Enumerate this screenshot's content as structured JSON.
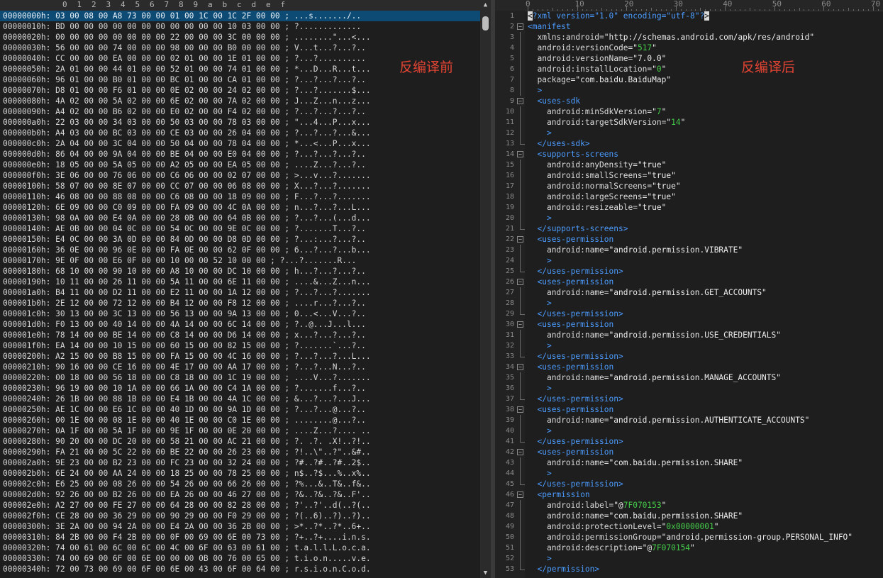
{
  "labels": {
    "before": "反编译前",
    "after": "反编译后"
  },
  "hex": {
    "ruler": [
      "0",
      "1",
      "2",
      "3",
      "4",
      "5",
      "6",
      "7",
      "8",
      "9",
      "a",
      "b",
      "c",
      "d",
      "e",
      "f"
    ],
    "rows": [
      "00000000h: 03 00 08 00 A8 73 00 00 01 00 1C 00 1C 2F 00 00 ; ...s......./..",
      "00000010h: BD 00 00 00 00 00 00 00 00 00 00 00 10 03 00 00 ; ?.............",
      "00000020h: 00 00 00 00 00 00 00 00 22 00 00 00 3C 00 00 00 ; ........\"...<...",
      "00000030h: 56 00 00 00 74 00 00 00 98 00 00 00 B0 00 00 00 ; V...t...?...?..",
      "00000040h: CC 00 00 00 EA 00 00 00 02 01 00 00 1E 01 00 00 ; ?...?..........",
      "00000050h: 2A 01 00 00 44 01 00 00 52 01 00 00 74 01 00 00 ; *...D...R...t...",
      "00000060h: 96 01 00 00 B0 01 00 00 BC 01 00 00 CA 01 00 00 ; ?...?...?...?..",
      "00000070h: D8 01 00 00 F6 01 00 00 0E 02 00 00 24 02 00 00 ; ?...?.......$...",
      "00000080h: 4A 02 00 00 5A 02 00 00 6E 02 00 00 7A 02 00 00 ; J...Z...n...z...",
      "00000090h: A4 02 00 00 B6 02 00 00 E0 02 00 00 F4 02 00 00 ; ?...?...?...?..",
      "000000a0h: 22 03 00 00 34 03 00 00 50 03 00 00 78 03 00 00 ; \"...4...P...x...",
      "000000b0h: A4 03 00 00 BC 03 00 00 CE 03 00 00 26 04 00 00 ; ?...?...?...&...",
      "000000c0h: 2A 04 00 00 3C 04 00 00 50 04 00 00 78 04 00 00 ; *...<...P...x...",
      "000000d0h: 86 04 00 00 9A 04 00 00 BE 04 00 00 E0 04 00 00 ; ?...?...?...?..",
      "000000e0h: 18 05 00 00 5A 05 00 00 A2 05 00 00 EA 05 00 00 ; ....Z...?...?..",
      "000000f0h: 3E 06 00 00 76 06 00 00 C6 06 00 00 02 07 00 00 ; >...v...?.......",
      "00000100h: 58 07 00 00 8E 07 00 00 CC 07 00 00 06 08 00 00 ; X...?...?.......",
      "00000110h: 46 08 00 00 88 08 00 00 C6 08 00 00 18 09 00 00 ; F...?...?.......",
      "00000120h: 6E 09 00 00 C0 09 00 00 FA 09 00 00 4C 0A 00 00 ; n...?...?...L...",
      "00000130h: 98 0A 00 00 E4 0A 00 00 28 0B 00 00 64 0B 00 00 ; ?...?...(...d...",
      "00000140h: AE 0B 00 00 04 0C 00 00 54 0C 00 00 9E 0C 00 00 ; ?.......T...?..",
      "00000150h: E4 0C 00 00 3A 0D 00 00 84 0D 00 00 D8 0D 00 00 ; ?...:...?...?..",
      "00000160h: 36 0E 00 00 96 0E 00 00 FA 0E 00 00 62 0F 00 00 ; 6...?...?...b...",
      "00000170h: 9E 0F 00 00 E6 0F 00 00 10 00 00 52 10 00 00 ; ?...?.......R...",
      "00000180h: 68 10 00 00 90 10 00 00 A8 10 00 00 DC 10 00 00 ; h...?...?...?..",
      "00000190h: 10 11 00 00 26 11 00 00 5A 11 00 00 6E 11 00 00 ; ....&...Z...n...",
      "000001a0h: B4 11 00 00 D2 11 00 00 E2 11 00 00 1A 12 00 00 ; ?...?...?.......",
      "000001b0h: 2E 12 00 00 72 12 00 00 B4 12 00 00 F8 12 00 00 ; ....r...?...?..",
      "000001c0h: 30 13 00 00 3C 13 00 00 56 13 00 00 9A 13 00 00 ; 0...<...V...?..",
      "000001d0h: F0 13 00 00 40 14 00 00 4A 14 00 00 6C 14 00 00 ; ?..@...J...l...",
      "000001e0h: 78 14 00 00 BE 14 00 00 C8 14 00 00 D6 14 00 00 ; x...?...?...?..",
      "000001f0h: EA 14 00 00 10 15 00 00 60 15 00 00 82 15 00 00 ; ?.......`...?..",
      "00000200h: A2 15 00 00 B8 15 00 00 FA 15 00 00 4C 16 00 00 ; ?...?...?...L...",
      "00000210h: 90 16 00 00 CE 16 00 00 4E 17 00 00 AA 17 00 00 ; ?...?...N...?..",
      "00000220h: 00 18 00 00 56 18 00 00 C8 18 00 00 1C 19 00 00 ; ....V...?.......",
      "00000230h: 96 19 00 00 10 1A 00 00 66 1A 00 00 C4 1A 00 00 ; ?.......f...?..",
      "00000240h: 26 1B 00 00 88 1B 00 00 E4 1B 00 00 4A 1C 00 00 ; &...?...?...J...",
      "00000250h: AE 1C 00 00 E6 1C 00 00 40 1D 00 00 9A 1D 00 00 ; ?...?...@...?..",
      "00000260h: 00 1E 00 00 08 1E 00 00 40 1E 00 00 C0 1E 00 00 ; ........@...?..",
      "00000270h: 0A 1F 00 00 5A 1F 00 00 9E 1F 00 00 0E 20 00 00 ; ....Z...?.... ..",
      "00000280h: 90 20 00 00 DC 20 00 00 58 21 00 00 AC 21 00 00 ; ?. .?. .X!..?!..",
      "00000290h: FA 21 00 00 5C 22 00 00 BE 22 00 00 26 23 00 00 ; ?!..\\\"..?\"..&#..",
      "000002a0h: 9E 23 00 00 B2 23 00 00 FC 23 00 00 32 24 00 00 ; ?#..?#..?#..2$..",
      "000002b0h: 6E 24 00 00 AA 24 00 00 18 25 00 00 78 25 00 00 ; n$..?$...%..x%..",
      "000002c0h: E6 25 00 00 08 26 00 00 54 26 00 00 66 26 00 00 ; ?%...&..T&..f&..",
      "000002d0h: 92 26 00 00 B2 26 00 00 EA 26 00 00 46 27 00 00 ; ?&..?&..?&..F'..",
      "000002e0h: A2 27 00 00 FE 27 00 00 64 28 00 00 82 28 00 00 ; ?'..?'..d(..?(..",
      "000002f0h: CE 28 00 00 36 29 00 00 90 29 00 00 F0 29 00 00 ; ?(..6)..?)..?)..",
      "00000300h: 3E 2A 00 00 94 2A 00 00 E4 2A 00 00 36 2B 00 00 ; >*..?*..?*..6+..",
      "00000310h: 84 2B 00 00 F4 2B 00 00 0F 00 69 00 6E 00 73 00 ; ?+..?+....i.n.s.",
      "00000320h: 74 00 61 00 6C 00 6C 00 4C 00 6F 00 63 00 61 00 ; t.a.l.l.L.o.c.a.",
      "00000330h: 74 00 69 00 6F 00 6E 00 00 00 0B 00 76 00 65 00 ; t.i.o.n.....v.e.",
      "00000340h: 72 00 73 00 69 00 6F 00 6E 00 43 00 6F 00 64 00 ; r.s.i.o.n.C.o.d."
    ]
  },
  "xml": {
    "ruler": [
      "0",
      "10",
      "20",
      "30",
      "40",
      "50",
      "60",
      "70"
    ],
    "lines": [
      {
        "n": "1",
        "ind": 0,
        "fold": "none",
        "parts": [
          [
            "pi",
            "<?xml version=\"1.0\" encoding=\"utf-8\"?>"
          ]
        ]
      },
      {
        "n": "2",
        "ind": 0,
        "fold": "open",
        "parts": [
          [
            "tag",
            "<manifest"
          ]
        ]
      },
      {
        "n": "3",
        "ind": 1,
        "fold": "line",
        "parts": [
          [
            "attr",
            "xmlns:android="
          ],
          [
            "str",
            "\"http://schemas.android.com/apk/res/android\""
          ]
        ]
      },
      {
        "n": "4",
        "ind": 1,
        "fold": "line",
        "parts": [
          [
            "attr",
            "android:versionCode="
          ],
          [
            "str",
            "\""
          ],
          [
            "num",
            "517"
          ],
          [
            "str",
            "\""
          ]
        ]
      },
      {
        "n": "5",
        "ind": 1,
        "fold": "line",
        "parts": [
          [
            "attr",
            "android:versionName="
          ],
          [
            "str",
            "\"7.0.0\""
          ]
        ]
      },
      {
        "n": "6",
        "ind": 1,
        "fold": "line",
        "parts": [
          [
            "attr",
            "android:installLocation="
          ],
          [
            "str",
            "\""
          ],
          [
            "num",
            "0"
          ],
          [
            "str",
            "\""
          ]
        ]
      },
      {
        "n": "7",
        "ind": 1,
        "fold": "line",
        "parts": [
          [
            "attr",
            "package="
          ],
          [
            "str",
            "\"com.baidu.BaiduMap\""
          ]
        ]
      },
      {
        "n": "8",
        "ind": 1,
        "fold": "line",
        "parts": [
          [
            "tag",
            ">"
          ]
        ]
      },
      {
        "n": "9",
        "ind": 1,
        "fold": "open",
        "parts": [
          [
            "tag",
            "<uses-sdk"
          ]
        ]
      },
      {
        "n": "10",
        "ind": 2,
        "fold": "line",
        "parts": [
          [
            "attr",
            "android:minSdkVersion="
          ],
          [
            "str",
            "\""
          ],
          [
            "num",
            "7"
          ],
          [
            "str",
            "\""
          ]
        ]
      },
      {
        "n": "11",
        "ind": 2,
        "fold": "line",
        "parts": [
          [
            "attr",
            "android:targetSdkVersion="
          ],
          [
            "str",
            "\""
          ],
          [
            "num",
            "14"
          ],
          [
            "str",
            "\""
          ]
        ]
      },
      {
        "n": "12",
        "ind": 2,
        "fold": "line",
        "parts": [
          [
            "tag",
            ">"
          ]
        ]
      },
      {
        "n": "13",
        "ind": 1,
        "fold": "end",
        "parts": [
          [
            "tag",
            "</uses-sdk>"
          ]
        ]
      },
      {
        "n": "14",
        "ind": 1,
        "fold": "open",
        "parts": [
          [
            "tag",
            "<supports-screens"
          ]
        ]
      },
      {
        "n": "15",
        "ind": 2,
        "fold": "line",
        "parts": [
          [
            "attr",
            "android:anyDensity="
          ],
          [
            "str",
            "\"true\""
          ]
        ]
      },
      {
        "n": "16",
        "ind": 2,
        "fold": "line",
        "parts": [
          [
            "attr",
            "android:smallScreens="
          ],
          [
            "str",
            "\"true\""
          ]
        ]
      },
      {
        "n": "17",
        "ind": 2,
        "fold": "line",
        "parts": [
          [
            "attr",
            "android:normalScreens="
          ],
          [
            "str",
            "\"true\""
          ]
        ]
      },
      {
        "n": "18",
        "ind": 2,
        "fold": "line",
        "parts": [
          [
            "attr",
            "android:largeScreens="
          ],
          [
            "str",
            "\"true\""
          ]
        ]
      },
      {
        "n": "19",
        "ind": 2,
        "fold": "line",
        "parts": [
          [
            "attr",
            "android:resizeable="
          ],
          [
            "str",
            "\"true\""
          ]
        ]
      },
      {
        "n": "20",
        "ind": 2,
        "fold": "line",
        "parts": [
          [
            "tag",
            ">"
          ]
        ]
      },
      {
        "n": "21",
        "ind": 1,
        "fold": "end",
        "parts": [
          [
            "tag",
            "</supports-screens>"
          ]
        ]
      },
      {
        "n": "22",
        "ind": 1,
        "fold": "open",
        "parts": [
          [
            "tag",
            "<uses-permission"
          ]
        ]
      },
      {
        "n": "23",
        "ind": 2,
        "fold": "line",
        "parts": [
          [
            "attr",
            "android:name="
          ],
          [
            "str",
            "\"android.permission.VIBRATE\""
          ]
        ]
      },
      {
        "n": "24",
        "ind": 2,
        "fold": "line",
        "parts": [
          [
            "tag",
            ">"
          ]
        ]
      },
      {
        "n": "25",
        "ind": 1,
        "fold": "end",
        "parts": [
          [
            "tag",
            "</uses-permission>"
          ]
        ]
      },
      {
        "n": "26",
        "ind": 1,
        "fold": "open",
        "parts": [
          [
            "tag",
            "<uses-permission"
          ]
        ]
      },
      {
        "n": "27",
        "ind": 2,
        "fold": "line",
        "parts": [
          [
            "attr",
            "android:name="
          ],
          [
            "str",
            "\"android.permission.GET_ACCOUNTS\""
          ]
        ]
      },
      {
        "n": "28",
        "ind": 2,
        "fold": "line",
        "parts": [
          [
            "tag",
            ">"
          ]
        ]
      },
      {
        "n": "29",
        "ind": 1,
        "fold": "end",
        "parts": [
          [
            "tag",
            "</uses-permission>"
          ]
        ]
      },
      {
        "n": "30",
        "ind": 1,
        "fold": "open",
        "parts": [
          [
            "tag",
            "<uses-permission"
          ]
        ]
      },
      {
        "n": "31",
        "ind": 2,
        "fold": "line",
        "parts": [
          [
            "attr",
            "android:name="
          ],
          [
            "str",
            "\"android.permission.USE_CREDENTIALS\""
          ]
        ]
      },
      {
        "n": "32",
        "ind": 2,
        "fold": "line",
        "parts": [
          [
            "tag",
            ">"
          ]
        ]
      },
      {
        "n": "33",
        "ind": 1,
        "fold": "end",
        "parts": [
          [
            "tag",
            "</uses-permission>"
          ]
        ]
      },
      {
        "n": "34",
        "ind": 1,
        "fold": "open",
        "parts": [
          [
            "tag",
            "<uses-permission"
          ]
        ]
      },
      {
        "n": "35",
        "ind": 2,
        "fold": "line",
        "parts": [
          [
            "attr",
            "android:name="
          ],
          [
            "str",
            "\"android.permission.MANAGE_ACCOUNTS\""
          ]
        ]
      },
      {
        "n": "36",
        "ind": 2,
        "fold": "line",
        "parts": [
          [
            "tag",
            ">"
          ]
        ]
      },
      {
        "n": "37",
        "ind": 1,
        "fold": "end",
        "parts": [
          [
            "tag",
            "</uses-permission>"
          ]
        ]
      },
      {
        "n": "38",
        "ind": 1,
        "fold": "open",
        "parts": [
          [
            "tag",
            "<uses-permission"
          ]
        ]
      },
      {
        "n": "39",
        "ind": 2,
        "fold": "line",
        "parts": [
          [
            "attr",
            "android:name="
          ],
          [
            "str",
            "\"android.permission.AUTHENTICATE_ACCOUNTS\""
          ]
        ]
      },
      {
        "n": "40",
        "ind": 2,
        "fold": "line",
        "parts": [
          [
            "tag",
            ">"
          ]
        ]
      },
      {
        "n": "41",
        "ind": 1,
        "fold": "end",
        "parts": [
          [
            "tag",
            "</uses-permission>"
          ]
        ]
      },
      {
        "n": "42",
        "ind": 1,
        "fold": "open",
        "parts": [
          [
            "tag",
            "<uses-permission"
          ]
        ]
      },
      {
        "n": "43",
        "ind": 2,
        "fold": "line",
        "parts": [
          [
            "attr",
            "android:name="
          ],
          [
            "str",
            "\"com.baidu.permission.SHARE\""
          ]
        ]
      },
      {
        "n": "44",
        "ind": 2,
        "fold": "line",
        "parts": [
          [
            "tag",
            ">"
          ]
        ]
      },
      {
        "n": "45",
        "ind": 1,
        "fold": "end",
        "parts": [
          [
            "tag",
            "</uses-permission>"
          ]
        ]
      },
      {
        "n": "46",
        "ind": 1,
        "fold": "open",
        "parts": [
          [
            "tag",
            "<permission"
          ]
        ]
      },
      {
        "n": "47",
        "ind": 2,
        "fold": "line",
        "parts": [
          [
            "attr",
            "android:label="
          ],
          [
            "str",
            "\"@"
          ],
          [
            "num",
            "7F070153"
          ],
          [
            "str",
            "\""
          ]
        ]
      },
      {
        "n": "48",
        "ind": 2,
        "fold": "line",
        "parts": [
          [
            "attr",
            "android:name="
          ],
          [
            "str",
            "\"com.baidu.permission.SHARE\""
          ]
        ]
      },
      {
        "n": "49",
        "ind": 2,
        "fold": "line",
        "parts": [
          [
            "attr",
            "android:protectionLevel="
          ],
          [
            "str",
            "\""
          ],
          [
            "num",
            "0x00000001"
          ],
          [
            "str",
            "\""
          ]
        ]
      },
      {
        "n": "50",
        "ind": 2,
        "fold": "line",
        "parts": [
          [
            "attr",
            "android:permissionGroup="
          ],
          [
            "str",
            "\"android.permission-group.PERSONAL_INFO\""
          ]
        ]
      },
      {
        "n": "51",
        "ind": 2,
        "fold": "line",
        "parts": [
          [
            "attr",
            "android:description="
          ],
          [
            "str",
            "\"@"
          ],
          [
            "num",
            "7F070154"
          ],
          [
            "str",
            "\""
          ]
        ]
      },
      {
        "n": "52",
        "ind": 2,
        "fold": "line",
        "parts": [
          [
            "tag",
            ">"
          ]
        ]
      },
      {
        "n": "53",
        "ind": 1,
        "fold": "end",
        "parts": [
          [
            "tag",
            "</permission>"
          ]
        ]
      }
    ]
  },
  "colors": {
    "label": "#e24433",
    "tag": "#4c9cff",
    "number": "#45cf4a",
    "selection": "#0d4a74"
  }
}
